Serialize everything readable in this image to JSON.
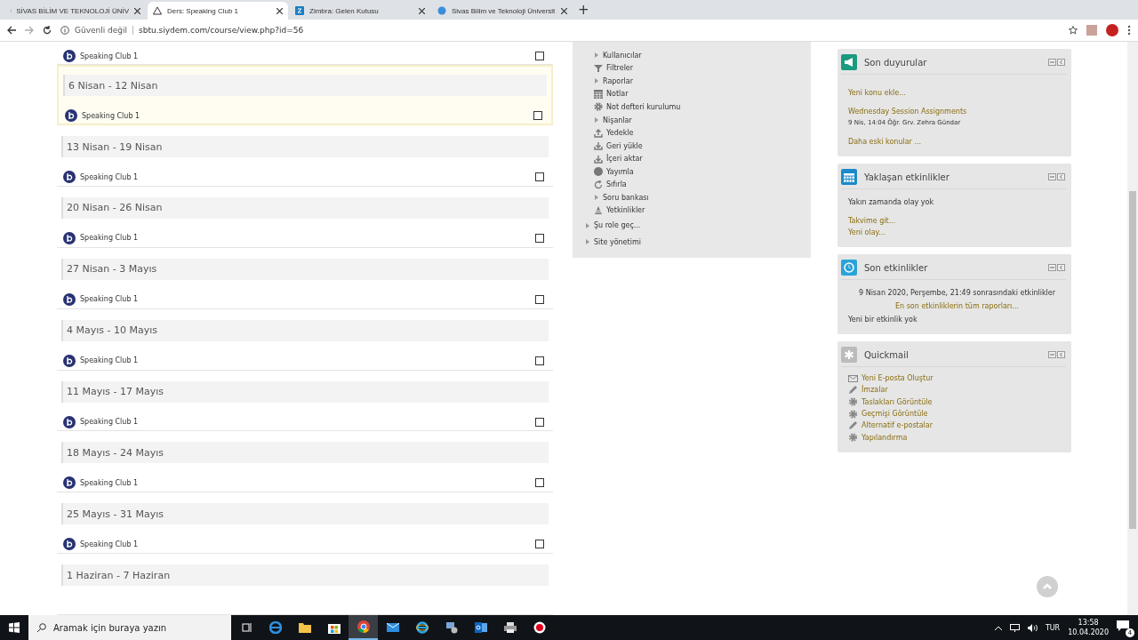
{
  "browser": {
    "tabs": [
      {
        "title": "SİVAS BİLİM VE TEKNOLOJİ ÜNİV",
        "selected": false,
        "kind": "globe"
      },
      {
        "title": "Ders: Speaking Club 1",
        "selected": true,
        "kind": "moodle"
      },
      {
        "title": "Zimbra: Gelen Kutusu",
        "selected": false,
        "kind": "zimbra"
      },
      {
        "title": "Sivas Bilim ve Teknoloji Üniversit",
        "selected": false,
        "kind": "globe"
      }
    ],
    "new_tab": "+",
    "security": "Güvenli değil",
    "url": "sbtu.siydem.com/course/view.php?id=56"
  },
  "course": {
    "top_activity": {
      "name": "Speaking Club 1",
      "checked": false
    },
    "sections": [
      {
        "title": "6 Nisan - 12 Nisan",
        "current": true,
        "activity": {
          "name": "Speaking Club 1",
          "checked": false
        }
      },
      {
        "title": "13 Nisan - 19 Nisan",
        "current": false,
        "activity": {
          "name": "Speaking Club 1",
          "checked": false
        }
      },
      {
        "title": "20 Nisan - 26 Nisan",
        "current": false,
        "activity": {
          "name": "Speaking Club 1",
          "checked": false
        }
      },
      {
        "title": "27 Nisan - 3 Mayıs",
        "current": false,
        "activity": {
          "name": "Speaking Club 1",
          "checked": false
        }
      },
      {
        "title": "4 Mayıs - 10 Mayıs",
        "current": false,
        "activity": {
          "name": "Speaking Club 1",
          "checked": false
        }
      },
      {
        "title": "11 Mayıs - 17 Mayıs",
        "current": false,
        "activity": {
          "name": "Speaking Club 1",
          "checked": false
        }
      },
      {
        "title": "18 Mayıs - 24 Mayıs",
        "current": false,
        "activity": {
          "name": "Speaking Club 1",
          "checked": false
        }
      },
      {
        "title": "25 Mayıs - 31 Mayıs",
        "current": false,
        "activity": {
          "name": "Speaking Club 1",
          "checked": false
        }
      },
      {
        "title": "1 Haziran - 7 Haziran",
        "current": false
      }
    ]
  },
  "administration": {
    "items": [
      {
        "label": "Kullanıcılar",
        "kind": "expand"
      },
      {
        "label": "Filtreler",
        "kind": "filter"
      },
      {
        "label": "Raporlar",
        "kind": "expand"
      },
      {
        "label": "Notlar",
        "kind": "grid"
      },
      {
        "label": "Not defteri kurulumu",
        "kind": "gear"
      },
      {
        "label": "Nişanlar",
        "kind": "expand"
      },
      {
        "label": "Yedekle",
        "kind": "upload"
      },
      {
        "label": "Geri yükle",
        "kind": "download"
      },
      {
        "label": "İçeri aktar",
        "kind": "download"
      },
      {
        "label": "Yayımla",
        "kind": "globe"
      },
      {
        "label": "Sıfırla",
        "kind": "reset"
      },
      {
        "label": "Soru bankası",
        "kind": "expand"
      },
      {
        "label": "Yetkinlikler",
        "kind": "cone"
      }
    ],
    "top_items": [
      {
        "label": "Şu role geç..."
      },
      {
        "label": "Site yönetimi"
      }
    ]
  },
  "blocks": [
    {
      "title": "Son duyurular",
      "kind": "announce",
      "lines": [
        {
          "text": "Yeni konu ekle...",
          "kind": "link"
        },
        {
          "text": "Wednesday Session Assignments",
          "kind": "post_title"
        },
        {
          "text": "9 Nis, 14:04  Öğr. Grv. Zehra Gündar",
          "kind": "meta"
        },
        {
          "text": "Daha eski konular ...",
          "kind": "link"
        }
      ]
    },
    {
      "title": "Yaklaşan etkinlikler",
      "kind": "calendar",
      "lines": [
        {
          "text": "Yakın zamanda olay yok",
          "kind": "text"
        },
        {
          "text": "Takvime git...",
          "kind": "link"
        },
        {
          "text": "Yeni olay...",
          "kind": "link_tight"
        }
      ]
    },
    {
      "title": "Son etkinlikler",
      "kind": "clock",
      "lines": [
        {
          "text": "9 Nisan 2020, Perşembe, 21:49 sonrasındaki etkinlikler",
          "kind": "center"
        },
        {
          "text": "En son etkinliklerin tüm raporları...",
          "kind": "center_link"
        },
        {
          "text": "Yeni bir etkinlik yok",
          "kind": "text"
        }
      ]
    },
    {
      "title": "Quickmail",
      "kind": "star",
      "links": [
        {
          "text": "Yeni E-posta Oluştur",
          "kind": "mail"
        },
        {
          "text": "İmzalar",
          "kind": "pencil"
        },
        {
          "text": "Taslakları Görüntüle",
          "kind": "gear"
        },
        {
          "text": "Geçmişi Görüntüle",
          "kind": "gear"
        },
        {
          "text": "Alternatif e-postalar",
          "kind": "pencil"
        },
        {
          "text": "Yapılandırma",
          "kind": "gear"
        }
      ]
    }
  ],
  "taskbar": {
    "search_placeholder": "Aramak için buraya yazın",
    "apps": [
      {
        "kind": "taskview",
        "active": false
      },
      {
        "kind": "edge",
        "active": false
      },
      {
        "kind": "folder",
        "active": false
      },
      {
        "kind": "store",
        "active": false
      },
      {
        "kind": "chrome",
        "active": true
      },
      {
        "kind": "mail",
        "active": false
      },
      {
        "kind": "ie",
        "active": false
      },
      {
        "kind": "network",
        "active": false
      },
      {
        "kind": "outlook",
        "active": false
      },
      {
        "kind": "printer",
        "active": false
      },
      {
        "kind": "record",
        "active": false
      }
    ],
    "language": "TUR",
    "time": "13:58",
    "date": "10.04.2020",
    "notifications": "4"
  }
}
